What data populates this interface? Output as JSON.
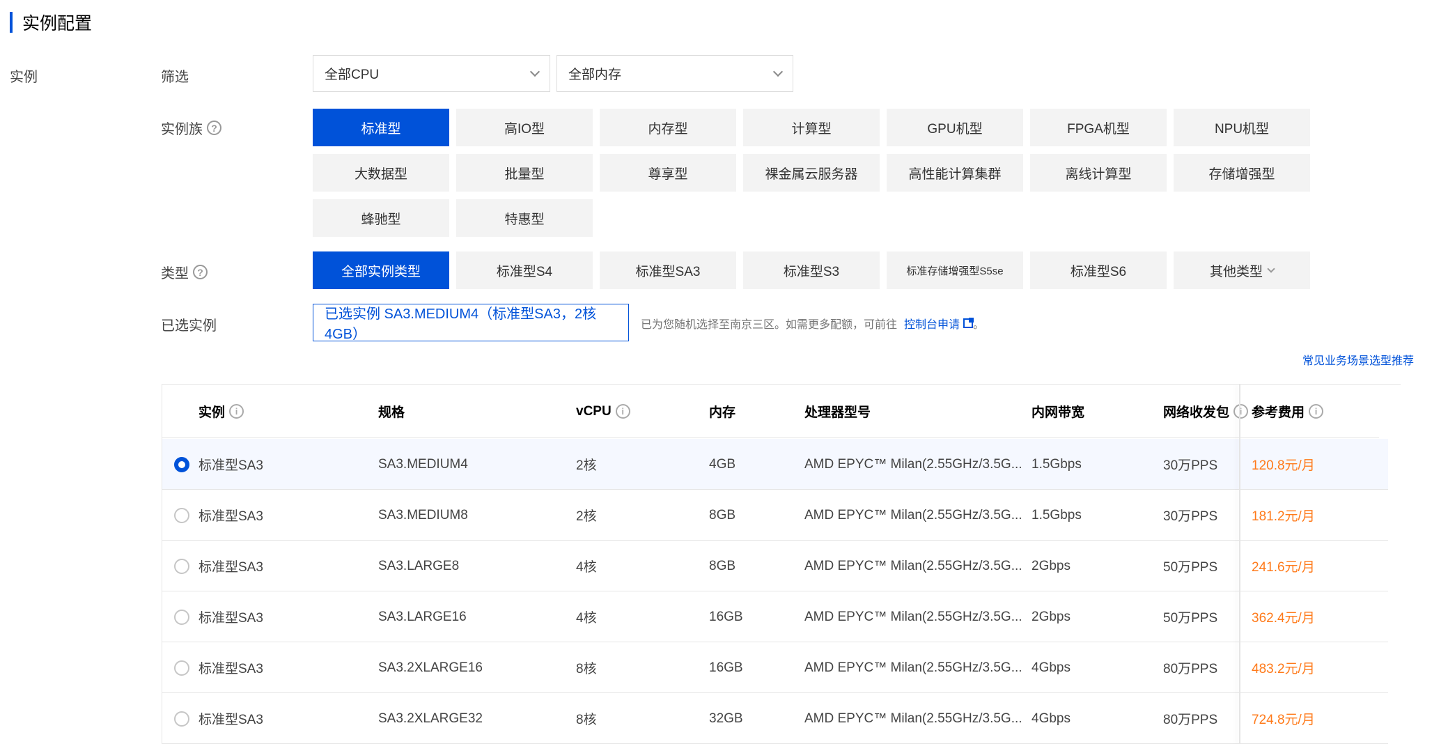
{
  "section_title": "实例配置",
  "left_label": "实例",
  "filter": {
    "label": "筛选",
    "cpu_select": "全部CPU",
    "mem_select": "全部内存"
  },
  "family": {
    "label": "实例族",
    "items": [
      "标准型",
      "高IO型",
      "内存型",
      "计算型",
      "GPU机型",
      "FPGA机型",
      "NPU机型",
      "大数据型",
      "批量型",
      "尊享型",
      "裸金属云服务器",
      "高性能计算集群",
      "离线计算型",
      "存储增强型",
      "蜂驰型",
      "特惠型"
    ],
    "active": "标准型"
  },
  "type": {
    "label": "类型",
    "items": [
      "全部实例类型",
      "标准型S4",
      "标准型SA3",
      "标准型S3",
      "标准存储增强型S5se",
      "标准型S6",
      "其他类型"
    ],
    "active": "全部实例类型"
  },
  "selected": {
    "label": "已选实例",
    "value": "已选实例 SA3.MEDIUM4（标准型SA3，2核 4GB）",
    "hint": "已为您随机选择至南京三区。如需更多配额，可前往",
    "link": "控制台申请",
    "hint_end": "。"
  },
  "recommend_link": "常见业务场景选型推荐",
  "table": {
    "headers": {
      "instance": "实例",
      "spec": "规格",
      "vcpu": "vCPU",
      "memory": "内存",
      "processor": "处理器型号",
      "bandwidth": "内网带宽",
      "pps": "网络收发包",
      "price": "参考费用"
    },
    "rows": [
      {
        "instance": "标准型SA3",
        "spec": "SA3.MEDIUM4",
        "vcpu": "2核",
        "memory": "4GB",
        "processor": "AMD EPYC™ Milan(2.55GHz/3.5G...",
        "bandwidth": "1.5Gbps",
        "pps": "30万PPS",
        "price": "120.8元/月",
        "selected": true
      },
      {
        "instance": "标准型SA3",
        "spec": "SA3.MEDIUM8",
        "vcpu": "2核",
        "memory": "8GB",
        "processor": "AMD EPYC™ Milan(2.55GHz/3.5G...",
        "bandwidth": "1.5Gbps",
        "pps": "30万PPS",
        "price": "181.2元/月",
        "selected": false
      },
      {
        "instance": "标准型SA3",
        "spec": "SA3.LARGE8",
        "vcpu": "4核",
        "memory": "8GB",
        "processor": "AMD EPYC™ Milan(2.55GHz/3.5G...",
        "bandwidth": "2Gbps",
        "pps": "50万PPS",
        "price": "241.6元/月",
        "selected": false
      },
      {
        "instance": "标准型SA3",
        "spec": "SA3.LARGE16",
        "vcpu": "4核",
        "memory": "16GB",
        "processor": "AMD EPYC™ Milan(2.55GHz/3.5G...",
        "bandwidth": "2Gbps",
        "pps": "50万PPS",
        "price": "362.4元/月",
        "selected": false
      },
      {
        "instance": "标准型SA3",
        "spec": "SA3.2XLARGE16",
        "vcpu": "8核",
        "memory": "16GB",
        "processor": "AMD EPYC™ Milan(2.55GHz/3.5G...",
        "bandwidth": "4Gbps",
        "pps": "80万PPS",
        "price": "483.2元/月",
        "selected": false
      },
      {
        "instance": "标准型SA3",
        "spec": "SA3.2XLARGE32",
        "vcpu": "8核",
        "memory": "32GB",
        "processor": "AMD EPYC™ Milan(2.55GHz/3.5G...",
        "bandwidth": "4Gbps",
        "pps": "80万PPS",
        "price": "724.8元/月",
        "selected": false
      }
    ]
  },
  "colors": {
    "accent": "#0052d9",
    "price": "#ff7a1a"
  }
}
